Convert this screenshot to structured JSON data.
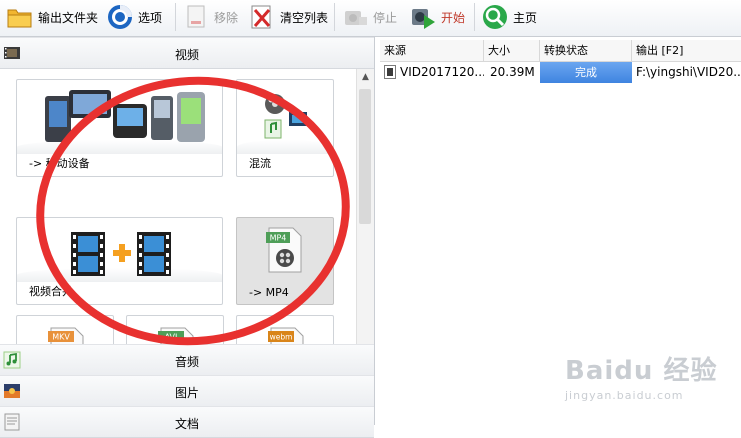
{
  "toolbar": {
    "output_folder": "输出文件夹",
    "options": "选项",
    "remove": "移除",
    "clear_list": "清空列表",
    "stop": "停止",
    "start": "开始",
    "home": "主页",
    "start_color": "#c0392b"
  },
  "categories": {
    "video": "视频",
    "audio": "音频",
    "image": "图片",
    "document": "文档"
  },
  "tiles": [
    {
      "label": "-> 移动设备",
      "icon": "mobile-devices-icon"
    },
    {
      "label": "混流",
      "icon": "mux-icon"
    },
    {
      "label": "视频合并",
      "icon": "video-joiner-icon"
    },
    {
      "label": "-> MP4",
      "icon": "mp4-file-icon",
      "badge": "MP4"
    },
    {
      "label": "",
      "icon": "mkv-file-icon",
      "badge": "MKV"
    },
    {
      "label": "",
      "icon": "avi-file-icon",
      "badge": "AVI"
    },
    {
      "label": "",
      "icon": "webm-file-icon",
      "badge": "webm"
    }
  ],
  "table": {
    "columns": [
      "来源",
      "大小",
      "转换状态",
      "输出 [F2]"
    ],
    "rows": [
      {
        "source": "VID2017120...",
        "size": "20.39M",
        "status": "完成",
        "output": "F:\\yingshi\\VID20..."
      }
    ]
  },
  "watermark": {
    "main": "Baidu 经验",
    "sub": "jingyan.baidu.com"
  },
  "colors": {
    "annotation_circle": "#e8312f",
    "status_fill": "#4a8fe6"
  }
}
